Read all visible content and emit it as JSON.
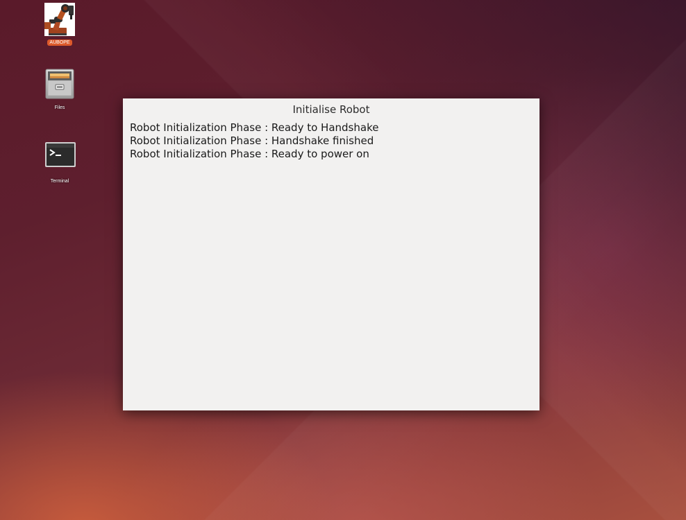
{
  "desktop": {
    "icons": [
      {
        "label": "AUBOPE",
        "icon": "robot-arm-icon",
        "selected": true
      },
      {
        "label": "Files",
        "icon": "file-cabinet-icon",
        "selected": false
      },
      {
        "label": "Terminal",
        "icon": "terminal-icon",
        "selected": false
      }
    ],
    "accent_color": "#dd5a2b"
  },
  "window": {
    "title": "Initialise Robot",
    "log_lines": [
      "Robot Initialization Phase : Ready to Handshake",
      "Robot Initialization Phase : Handshake finished",
      "Robot Initialization Phase : Ready to power on"
    ],
    "background_color": "#f2f1f0"
  }
}
